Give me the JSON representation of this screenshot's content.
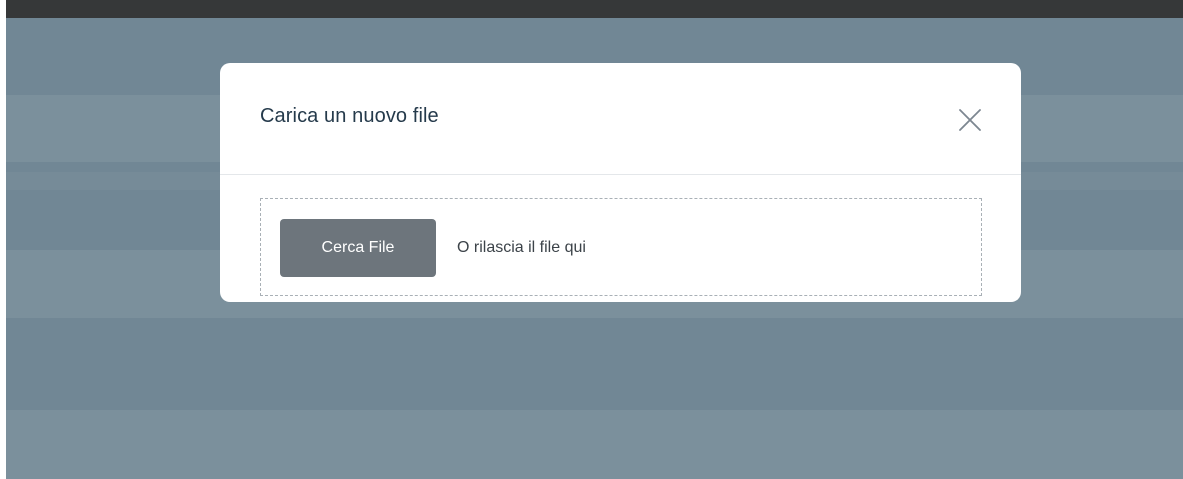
{
  "dialog": {
    "title": "Carica un nuovo file",
    "close_icon": "close-icon",
    "browse_button_label": "Cerca File",
    "drop_hint": "O rilascia il file qui"
  },
  "colors": {
    "backdrop": "#718795",
    "topbar": "#363839",
    "title_text": "#253a4b",
    "browse_button_bg": "#6d757c",
    "dropzone_border": "#a9b0b6"
  }
}
